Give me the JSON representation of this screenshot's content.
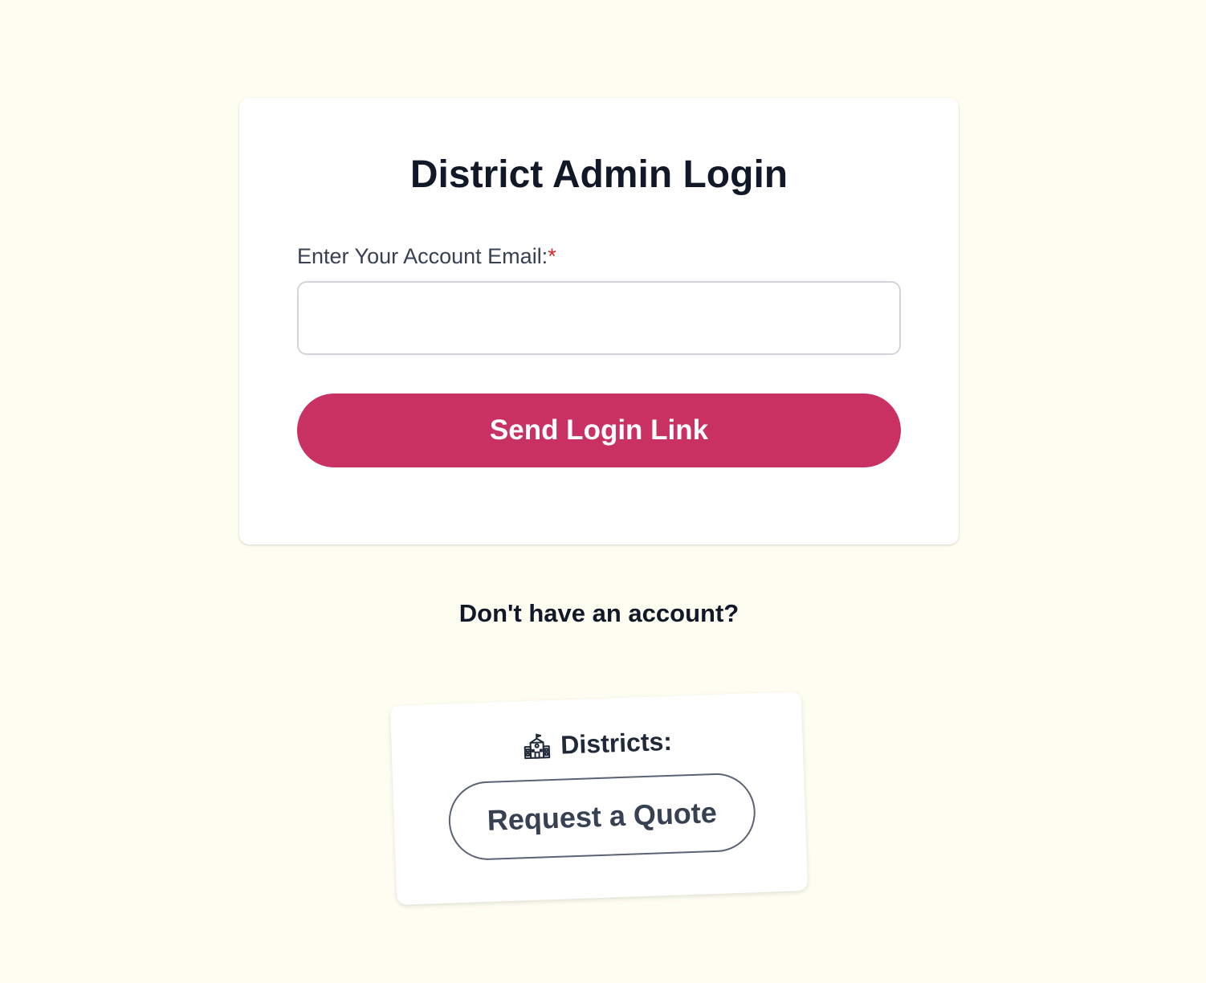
{
  "login": {
    "title": "District Admin Login",
    "email_label": "Enter Your Account Email:",
    "required_mark": "*",
    "email_value": "",
    "email_placeholder": "",
    "submit_label": "Send Login Link"
  },
  "signup": {
    "prompt": "Don't have an account?",
    "districts_label": "Districts:",
    "districts_icon": "school-building-icon",
    "quote_label": "Request a Quote"
  },
  "colors": {
    "background": "#fdfdf1",
    "accent": "#c93163",
    "text": "#111827",
    "required": "#dc2626"
  }
}
